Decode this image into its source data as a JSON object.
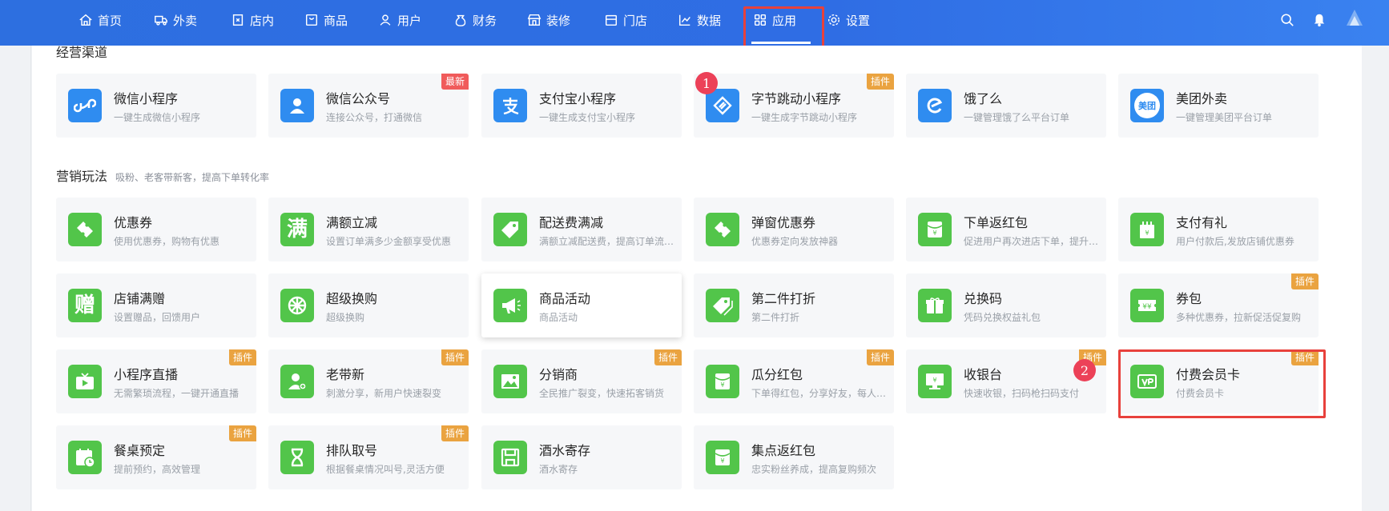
{
  "nav": {
    "items": [
      {
        "label": "首页",
        "icon": "home-icon"
      },
      {
        "label": "外卖",
        "icon": "delivery-icon"
      },
      {
        "label": "店内",
        "icon": "store-inside-icon"
      },
      {
        "label": "商品",
        "icon": "goods-icon"
      },
      {
        "label": "用户",
        "icon": "user-icon"
      },
      {
        "label": "财务",
        "icon": "finance-icon"
      },
      {
        "label": "装修",
        "icon": "decorate-icon"
      },
      {
        "label": "门店",
        "icon": "shop-icon"
      },
      {
        "label": "数据",
        "icon": "chart-icon"
      },
      {
        "label": "应用",
        "icon": "apps-icon",
        "active": true
      },
      {
        "label": "设置",
        "icon": "gear-icon"
      }
    ]
  },
  "sections": {
    "channels": {
      "title": "经营渠道"
    },
    "marketing": {
      "title": "营销玩法",
      "subtitle": "吸粉、老客带新客，提高下单转化率"
    }
  },
  "badges": {
    "new": "最新",
    "plugin": "插件"
  },
  "markers": {
    "one": "1",
    "two": "2"
  },
  "channels": [
    {
      "title": "微信小程序",
      "desc": "一键生成微信小程序"
    },
    {
      "title": "微信公众号",
      "desc": "连接公众号，打通微信",
      "badge": "最新"
    },
    {
      "title": "支付宝小程序",
      "desc": "一键生成支付宝小程序"
    },
    {
      "title": "字节跳动小程序",
      "desc": "一键生成字节跳动小程序",
      "badge": "插件"
    },
    {
      "title": "饿了么",
      "desc": "一键管理饿了么平台订单"
    },
    {
      "title": "美团外卖",
      "desc": "一键管理美团平台订单",
      "icon_text": "美团"
    }
  ],
  "marketing": [
    {
      "title": "优惠券",
      "desc": "使用优惠券，购物有优惠"
    },
    {
      "title": "满额立减",
      "desc": "设置订单满多少金额享受优惠",
      "icon_text": "满"
    },
    {
      "title": "配送费满减",
      "desc": "满额立减配送费，提高订单流…"
    },
    {
      "title": "弹窗优惠券",
      "desc": "优惠券定向发放神器"
    },
    {
      "title": "下单返红包",
      "desc": "促进用户再次进店下单，提升…"
    },
    {
      "title": "支付有礼",
      "desc": "用户付款后,发放店铺优惠券"
    },
    {
      "title": "店铺满赠",
      "desc": "设置赠品，回馈用户",
      "icon_text": "赠"
    },
    {
      "title": "超级换购",
      "desc": "超级换购"
    },
    {
      "title": "商品活动",
      "desc": "商品活动"
    },
    {
      "title": "第二件打折",
      "desc": "第二件打折"
    },
    {
      "title": "兑换码",
      "desc": "凭码兑换权益礼包"
    },
    {
      "title": "券包",
      "desc": "多种优惠券，拉新促活促复购",
      "badge": "插件"
    },
    {
      "title": "小程序直播",
      "desc": "无需繁琐流程，一键开通直播",
      "badge": "插件"
    },
    {
      "title": "老带新",
      "desc": "刺激分享，新用户快速裂变",
      "badge": "插件"
    },
    {
      "title": "分销商",
      "desc": "全民推广裂变，快速拓客销货",
      "badge": "插件"
    },
    {
      "title": "瓜分红包",
      "desc": "下单得红包，分享好友，每人…",
      "badge": "插件"
    },
    {
      "title": "收银台",
      "desc": "快速收银，扫码枪扫码支付",
      "badge": "插件"
    },
    {
      "title": "付费会员卡",
      "desc": "付费会员卡",
      "badge": "插件"
    },
    {
      "title": "餐桌预定",
      "desc": "提前预约，高效管理",
      "badge": "插件"
    },
    {
      "title": "排队取号",
      "desc": "根据餐桌情况叫号,灵活方便",
      "badge": "插件"
    },
    {
      "title": "酒水寄存",
      "desc": "酒水寄存"
    },
    {
      "title": "集点返红包",
      "desc": "忠实粉丝养成，提高复购频次"
    }
  ],
  "colors": {
    "nav": "#2f6de4",
    "blue_icon": "#2f8cf0",
    "green_icon": "#52c54a",
    "highlight": "#e8413c"
  }
}
